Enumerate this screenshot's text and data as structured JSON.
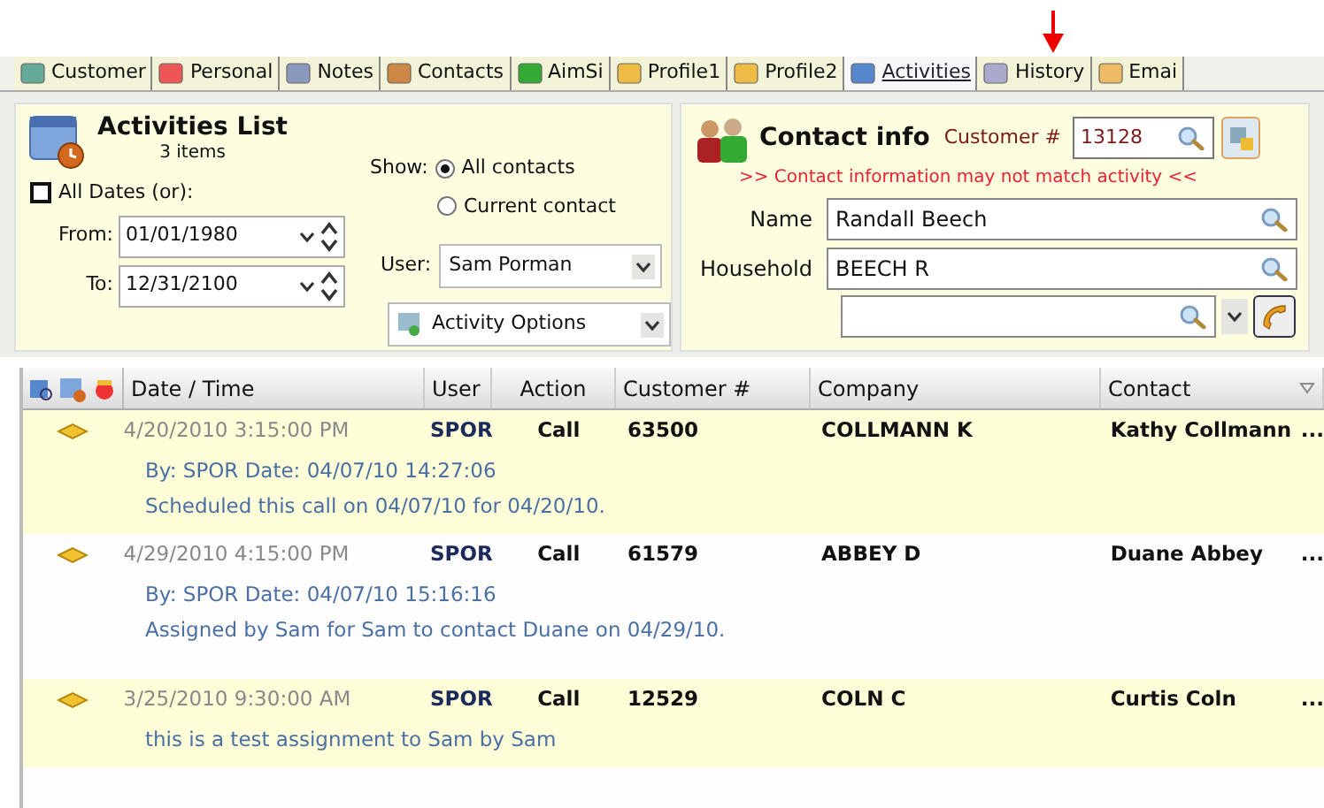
{
  "tabs": [
    {
      "label": "Customer",
      "selected": false
    },
    {
      "label": "Personal",
      "selected": false
    },
    {
      "label": "Notes",
      "selected": false
    },
    {
      "label": "Contacts",
      "selected": false
    },
    {
      "label": "AimSi",
      "selected": false
    },
    {
      "label": "Profile1",
      "selected": false
    },
    {
      "label": "Profile2",
      "selected": false
    },
    {
      "label": "Activities",
      "selected": true
    },
    {
      "label": "History",
      "selected": false
    },
    {
      "label": "Emai",
      "selected": false
    }
  ],
  "activities_panel": {
    "title": "Activities List",
    "count": "3 items",
    "all_dates": {
      "label": "All Dates (or):",
      "checked": false
    },
    "from": {
      "label": "From:",
      "value": "01/01/1980"
    },
    "to": {
      "label": "To:",
      "value": "12/31/2100"
    },
    "show_label": "Show:",
    "show_options": [
      {
        "label": "All contacts",
        "selected": true
      },
      {
        "label": "Current contact",
        "selected": false
      }
    ],
    "user": {
      "label": "User:",
      "value": "Sam Porman"
    },
    "options_button": "Activity Options"
  },
  "contact_panel": {
    "title": "Contact info",
    "customer_label": "Customer #",
    "customer_value": "13128",
    "warning": ">>  Contact information may not match activity  <<",
    "name": {
      "label": "Name",
      "value": "Randall Beech"
    },
    "household": {
      "label": "Household",
      "value": "BEECH R"
    }
  },
  "table": {
    "columns": [
      "Date / Time",
      "User",
      "Action",
      "Customer #",
      "Company",
      "Contact"
    ],
    "rows": [
      {
        "date": "4/20/2010 3:15:00 PM",
        "user": "SPOR",
        "action": "Call",
        "customer": "63500",
        "company": "COLLMANN K",
        "contact": "Kathy Collmann",
        "more": "...",
        "details": [
          "By: SPOR Date: 04/07/10 14:27:06",
          "Scheduled this call on 04/07/10 for 04/20/10."
        ],
        "selected": true
      },
      {
        "date": "4/29/2010 4:15:00 PM",
        "user": "SPOR",
        "action": "Call",
        "customer": "61579",
        "company": "ABBEY D",
        "contact": "Duane Abbey",
        "more": "...",
        "details": [
          "By: SPOR Date: 04/07/10 15:16:16",
          "Assigned by Sam for Sam to contact Duane on 04/29/10."
        ],
        "selected": false
      },
      {
        "date": "3/25/2010 9:30:00 AM",
        "user": "SPOR",
        "action": "Call",
        "customer": "12529",
        "company": "COLN C",
        "contact": "Curtis Coln",
        "more": "...",
        "details": [
          "this is a test assignment to Sam by Sam"
        ],
        "selected": true
      }
    ]
  }
}
